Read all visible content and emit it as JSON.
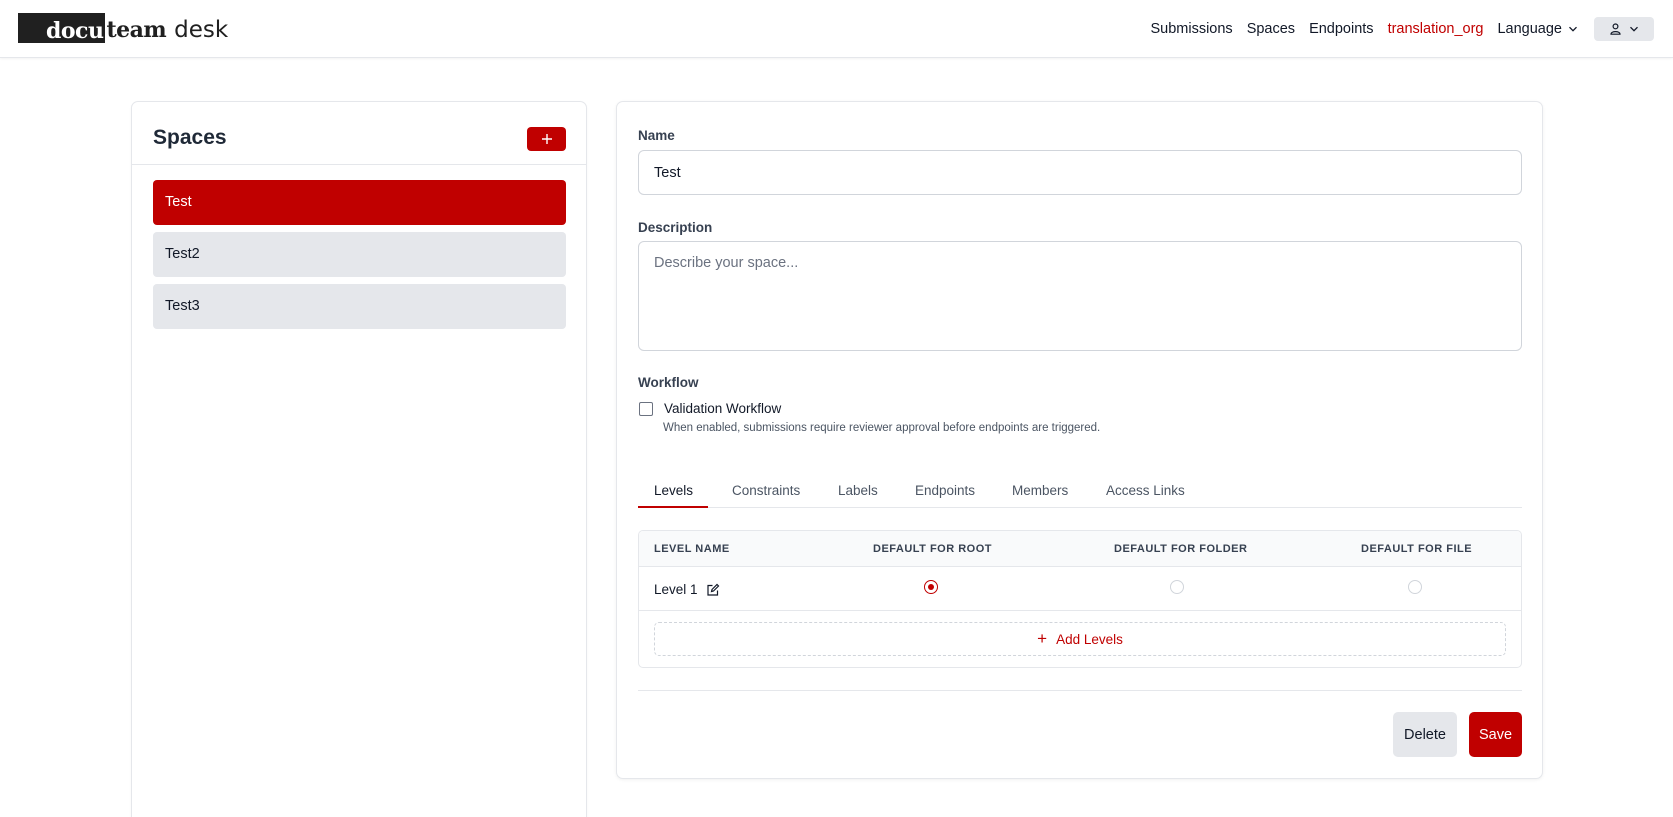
{
  "brand": {
    "logo_dark": "docu",
    "logo_team": "team",
    "logo_desk": "desk"
  },
  "nav": {
    "items": [
      "Submissions",
      "Spaces",
      "Endpoints"
    ],
    "org": "translation_org",
    "language": "Language",
    "user_icon": "user-icon",
    "org_color": "#c00000"
  },
  "spaces": {
    "title": "Spaces",
    "add_icon": "plus-icon",
    "items": [
      {
        "label": "Test",
        "active": true
      },
      {
        "label": "Test2",
        "active": false
      },
      {
        "label": "Test3",
        "active": false
      }
    ]
  },
  "form": {
    "name_label": "Name",
    "name_value": "Test",
    "description_label": "Description",
    "description_placeholder": "Describe your space...",
    "workflow_label": "Workflow",
    "validation_label": "Validation Workflow",
    "validation_checked": false,
    "validation_help": "When enabled, submissions require reviewer approval before endpoints are triggered."
  },
  "tabs": {
    "items": [
      "Levels",
      "Constraints",
      "Labels",
      "Endpoints",
      "Members",
      "Access Links"
    ],
    "active": "Levels"
  },
  "levels": {
    "columns": [
      "LEVEL NAME",
      "DEFAULT FOR ROOT",
      "DEFAULT FOR FOLDER",
      "DEFAULT FOR FILE"
    ],
    "rows": [
      {
        "name": "Level 1",
        "root": true,
        "folder": false,
        "file": false
      }
    ],
    "add_label": "Add Levels"
  },
  "actions": {
    "delete": "Delete",
    "save": "Save"
  },
  "colors": {
    "accent": "#c00000",
    "neutral": "#e5e7eb"
  }
}
